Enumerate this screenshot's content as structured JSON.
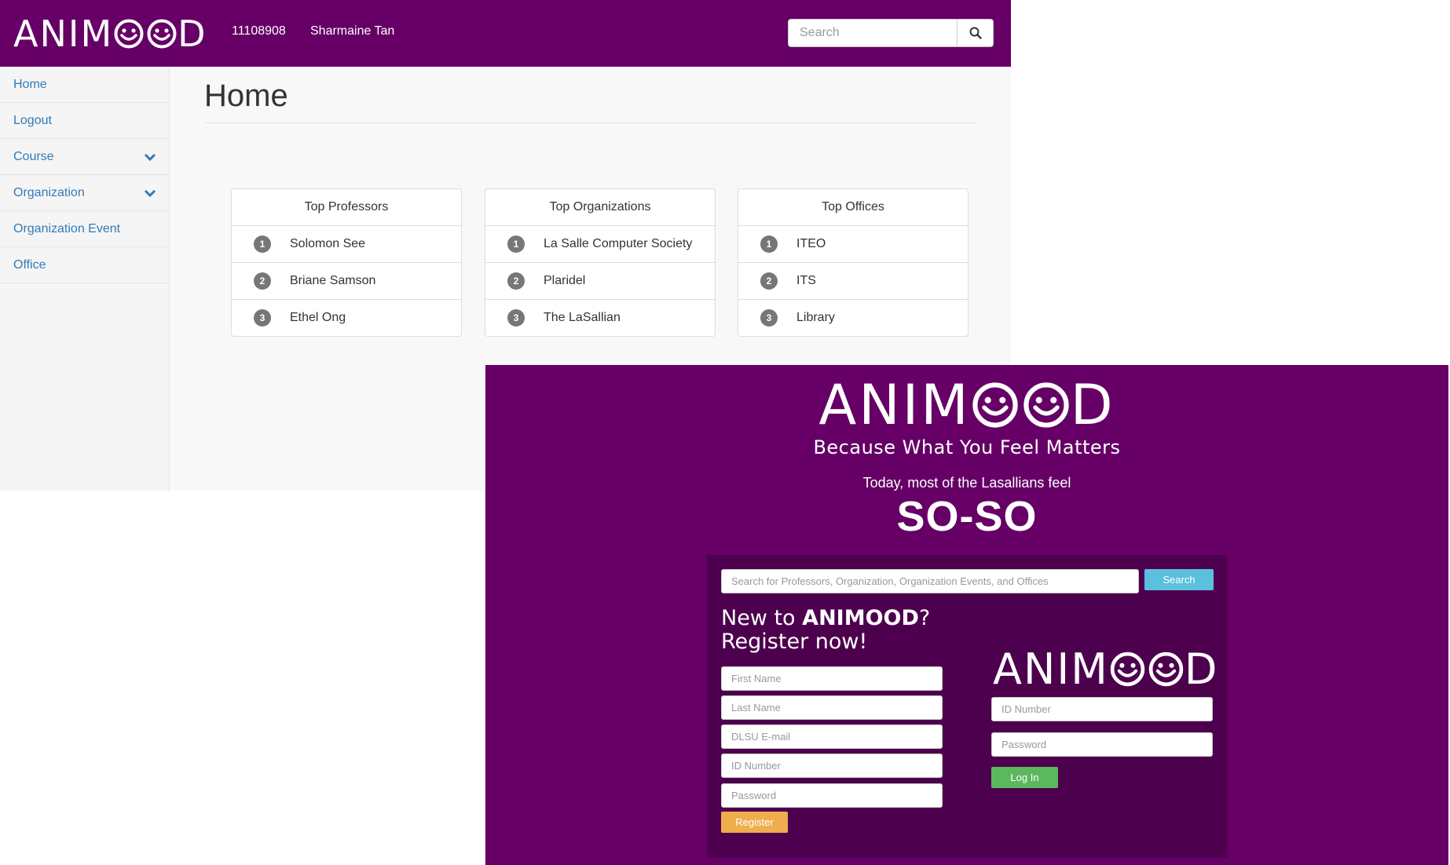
{
  "brand": {
    "name_pre": "ANIM",
    "name_post": "D",
    "tagline": "Because What You Feel Matters"
  },
  "colors": {
    "brand_purple": "#660066",
    "card_purple": "#4d004d",
    "link_blue": "#337ab7",
    "search_btn": "#5bc0de",
    "register_btn": "#f0ad4e",
    "login_btn": "#5cb85c"
  },
  "dashboard": {
    "header": {
      "user_id": "11108908",
      "user_name": "Sharmaine Tan",
      "search_placeholder": "Search",
      "search_icon": "search-icon"
    },
    "sidebar": {
      "items": [
        {
          "label": "Home",
          "has_dropdown": false
        },
        {
          "label": "Logout",
          "has_dropdown": false
        },
        {
          "label": "Course",
          "has_dropdown": true
        },
        {
          "label": "Organization",
          "has_dropdown": true
        },
        {
          "label": "Organization Event",
          "has_dropdown": false
        },
        {
          "label": "Office",
          "has_dropdown": false
        }
      ]
    },
    "page_title": "Home",
    "panels": [
      {
        "title": "Top Professors",
        "rows": [
          {
            "rank": "1",
            "name": "Solomon See"
          },
          {
            "rank": "2",
            "name": "Briane Samson"
          },
          {
            "rank": "3",
            "name": "Ethel Ong"
          }
        ]
      },
      {
        "title": "Top Organizations",
        "rows": [
          {
            "rank": "1",
            "name": "La Salle Computer Society"
          },
          {
            "rank": "2",
            "name": "Plaridel"
          },
          {
            "rank": "3",
            "name": "The LaSallian"
          }
        ]
      },
      {
        "title": "Top Offices",
        "rows": [
          {
            "rank": "1",
            "name": "ITEO"
          },
          {
            "rank": "2",
            "name": "ITS"
          },
          {
            "rank": "3",
            "name": "Library"
          }
        ]
      }
    ]
  },
  "landing": {
    "today_text": "Today, most of the Lasallians feel",
    "mood": "SO-SO",
    "search_placeholder": "Search for Professors, Organization, Organization Events, and Offices",
    "search_button": "Search",
    "register": {
      "heading_line1_pre": "New to ",
      "heading_brand": "ANIMOOD",
      "heading_line1_post": "?",
      "heading_line2": "Register now!",
      "fields": [
        {
          "placeholder": "First Name"
        },
        {
          "placeholder": "Last Name"
        },
        {
          "placeholder": "DLSU E-mail"
        },
        {
          "placeholder": "ID Number"
        },
        {
          "placeholder": "Password"
        }
      ],
      "button": "Register"
    },
    "login": {
      "fields": [
        {
          "placeholder": "ID Number"
        },
        {
          "placeholder": "Password"
        }
      ],
      "button": "Log In"
    }
  }
}
